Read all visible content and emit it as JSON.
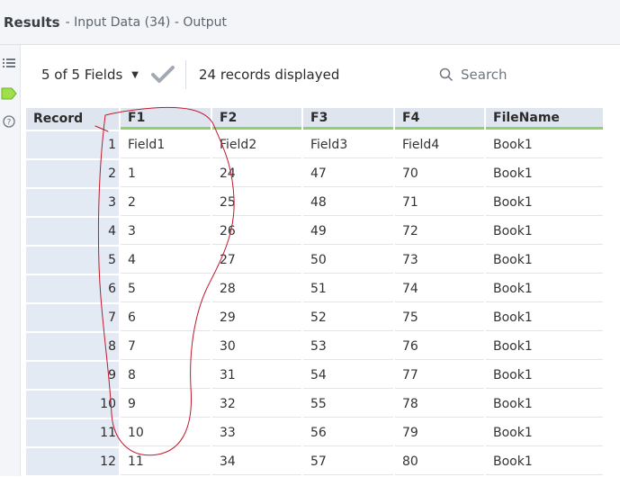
{
  "window": {
    "title": "Results",
    "subtitle": "- Input Data (34) - Output"
  },
  "toolbar": {
    "fields_label": "5 of 5 Fields",
    "records_label": "24 records displayed",
    "search_placeholder": "Search"
  },
  "table": {
    "headers": [
      "Record",
      "F1",
      "F2",
      "F3",
      "F4",
      "FileName"
    ],
    "rows": [
      [
        "1",
        "Field1",
        "Field2",
        "Field3",
        "Field4",
        "Book1"
      ],
      [
        "2",
        "1",
        "24",
        "47",
        "70",
        "Book1"
      ],
      [
        "3",
        "2",
        "25",
        "48",
        "71",
        "Book1"
      ],
      [
        "4",
        "3",
        "26",
        "49",
        "72",
        "Book1"
      ],
      [
        "5",
        "4",
        "27",
        "50",
        "73",
        "Book1"
      ],
      [
        "6",
        "5",
        "28",
        "51",
        "74",
        "Book1"
      ],
      [
        "7",
        "6",
        "29",
        "52",
        "75",
        "Book1"
      ],
      [
        "8",
        "7",
        "30",
        "53",
        "76",
        "Book1"
      ],
      [
        "9",
        "8",
        "31",
        "54",
        "77",
        "Book1"
      ],
      [
        "10",
        "9",
        "32",
        "55",
        "78",
        "Book1"
      ],
      [
        "11",
        "10",
        "33",
        "56",
        "79",
        "Book1"
      ],
      [
        "12",
        "11",
        "34",
        "57",
        "80",
        "Book1"
      ]
    ]
  },
  "colors": {
    "header_bg": "#dfe5ef",
    "accent_green": "#8fd16a",
    "annotation_red": "#c0182a"
  },
  "icons": {
    "rail": [
      "list-icon",
      "tag-icon",
      "help-icon"
    ],
    "toolbar": [
      "chevron-down-icon",
      "check-icon",
      "search-icon"
    ]
  }
}
